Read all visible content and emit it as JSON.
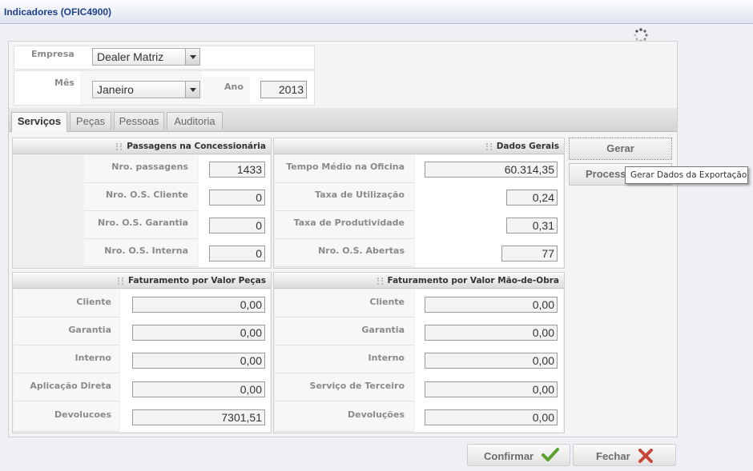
{
  "window": {
    "title": "Indicadores (OFIC4900)"
  },
  "header": {
    "empresa_label": "Empresa",
    "empresa_value": "Dealer Matriz",
    "mes_label": "Mês",
    "mes_value": "Janeiro",
    "ano_label": "Ano",
    "ano_value": "2013"
  },
  "tabs": [
    {
      "label": "Serviços"
    },
    {
      "label": "Peças"
    },
    {
      "label": "Pessoas"
    },
    {
      "label": "Auditoria"
    }
  ],
  "passagens": {
    "title": "Passagens na Concessionária",
    "rows": [
      {
        "label": "Nro. passagens",
        "value": "1433"
      },
      {
        "label": "Nro. O.S. Cliente",
        "value": "0"
      },
      {
        "label": "Nro. O.S. Garantia",
        "value": "0"
      },
      {
        "label": "Nro. O.S. Interna",
        "value": "0"
      }
    ]
  },
  "dados_gerais": {
    "title": "Dados Gerais",
    "rows": [
      {
        "label": "Tempo Médio na Oficina",
        "value": "60.314,35"
      },
      {
        "label": "Taxa de Utilização",
        "value": "0,24"
      },
      {
        "label": "Taxa de Produtividade",
        "value": "0,31"
      },
      {
        "label": "Nro. O.S. Abertas",
        "value": "77"
      }
    ]
  },
  "fat_pecas": {
    "title": "Faturamento por Valor Peças",
    "rows": [
      {
        "label": "Cliente",
        "value": "0,00"
      },
      {
        "label": "Garantia",
        "value": "0,00"
      },
      {
        "label": "Interno",
        "value": "0,00"
      },
      {
        "label": "Aplicação Direta",
        "value": "0,00"
      },
      {
        "label": "Devolucoes",
        "value": "7301,51"
      }
    ]
  },
  "fat_mo": {
    "title": "Faturamento por Valor Mão-de-Obra",
    "rows": [
      {
        "label": "Cliente",
        "value": "0,00"
      },
      {
        "label": "Garantia",
        "value": "0,00"
      },
      {
        "label": "Interno",
        "value": "0,00"
      },
      {
        "label": "Serviço de Terceiro",
        "value": "0,00"
      },
      {
        "label": "Devoluções",
        "value": "0,00"
      }
    ]
  },
  "side": {
    "gerar": "Gerar",
    "processar": "Processar"
  },
  "tooltip": "Gerar Dados da Exportação",
  "footer": {
    "confirmar": "Confirmar",
    "fechar": "Fechar"
  },
  "colors": {
    "title": "#1e3f8a",
    "confirm_icon": "#5aa02c",
    "close_icon": "#c8453a"
  },
  "icons": {
    "loading": "spinner-icon",
    "confirm": "checkmark-icon",
    "close": "close-x-icon",
    "combo": "chevron-down-icon"
  }
}
